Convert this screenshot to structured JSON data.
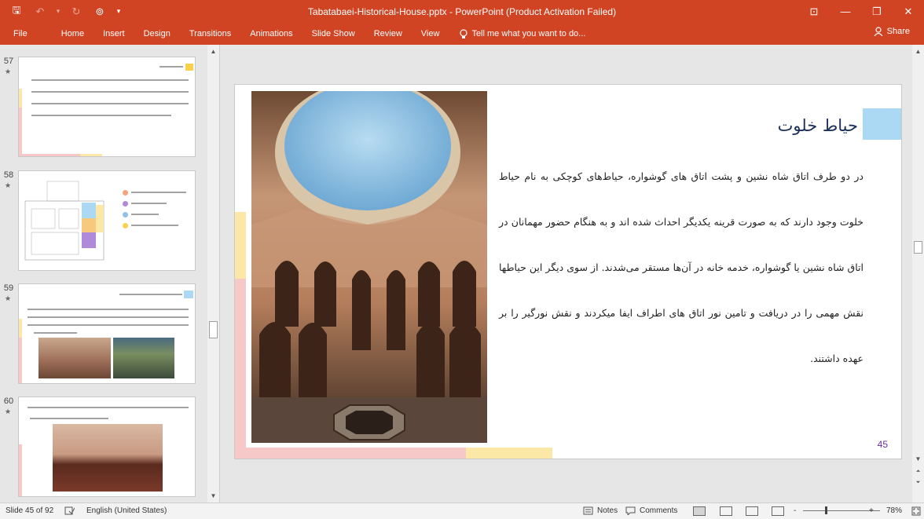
{
  "window": {
    "title": "Tabatabaei-Historical-House.pptx - PowerPoint (Product Activation Failed)",
    "controls": {
      "ribbon_display": "⊡",
      "minimize": "—",
      "restore": "❐",
      "close": "✕"
    }
  },
  "qat": {
    "save": "🖫",
    "undo": "↶",
    "undo_more": "▾",
    "redo": "↻",
    "present": "⊚",
    "customize": "▾"
  },
  "ribbon": {
    "tabs": [
      "File",
      "Home",
      "Insert",
      "Design",
      "Transitions",
      "Animations",
      "Slide Show",
      "Review",
      "View"
    ],
    "tell_me": "Tell me what you want to do...",
    "share": "Share"
  },
  "thumbnails": [
    {
      "number": "57",
      "star": "★"
    },
    {
      "number": "58",
      "star": "★"
    },
    {
      "number": "59",
      "star": "★"
    },
    {
      "number": "60",
      "star": "★"
    }
  ],
  "slide": {
    "title": "حیاط خلوت",
    "body": "در دو طرف اتاق شاه نشین و پشت اتاق های گوشواره، حیاط‌های کوچکی به نام حیاط خلوت وجود دارند که به صورت قرینه یکدیگر احداث شده اند و به هنگام حضور مهمانان در اتاق شاه نشین یا گوشواره، خدمه خانه در آن‌ها مستقر می‌شدند. از سوی دیگر این حیاطها نقش مهمی را در دریافت و تامین نور اتاق های اطراف ایفا میکردند و نقش نورگیر را بر عهده داشتند.",
    "page_number": "45"
  },
  "status": {
    "slide_info": "Slide 45 of 92",
    "language": "English (United States)",
    "notes": "Notes",
    "comments": "Comments",
    "zoom_minus": "-",
    "zoom_plus": "+",
    "zoom": "78%"
  },
  "colors": {
    "accent": "#d04423",
    "pink": "#f6c8c8",
    "yellow": "#fbe7a6",
    "blue": "#abd9f3",
    "title": "#1a2f5a",
    "pagenum": "#6a2ea0"
  }
}
